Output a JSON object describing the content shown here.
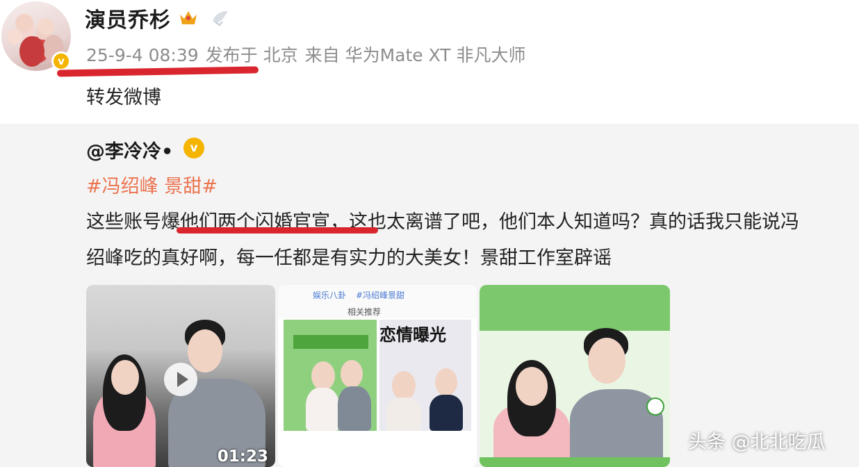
{
  "post": {
    "author": "演员乔杉",
    "timestamp": "25-9-4 08:39",
    "published_at_label": "发布于 北京",
    "source_label": "来自 华为Mate XT 非凡大师",
    "repost_text": "转发微博"
  },
  "quoted": {
    "author": "@李冷冷•",
    "hashtag": "#冯绍峰 景甜#",
    "body_line1": "这些账号爆他们两个闪婚官宣，这也太离谱了吧，他们本人知道吗？真的话我只能说冯",
    "body_line2": "绍峰吃的真好啊，每一任都是有实力的大美女！景甜工作室辟谣"
  },
  "media": {
    "video_duration": "01:23",
    "card_title": "恋情曝光",
    "card_header": "相关推荐",
    "card_tags": [
      "娱乐八卦",
      "#冯绍峰景甜"
    ]
  },
  "watermark": "头条 @北北吃瓜",
  "colors": {
    "accent_red": "#d9262e",
    "hashtag": "#eb7350",
    "verify_gold": "#f5b400",
    "meta_gray": "#8c8c8c"
  }
}
